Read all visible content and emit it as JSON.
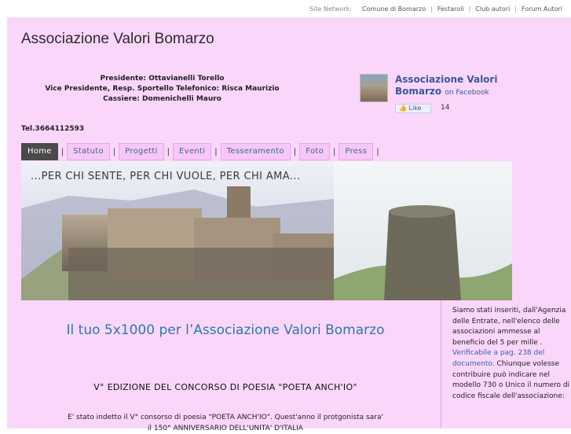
{
  "site_network": {
    "label": "Site Network:",
    "links": [
      "Comune di Bomarzo",
      "Festaroli",
      "Club autori",
      "Forum Autori"
    ],
    "separator": "|"
  },
  "header": {
    "title": "Associazione Valori Bomarzo",
    "officers": [
      "Presidente: Ottavianelli Torello",
      "Vice Presidente, Resp. Sportello Telefonico: Risca Maurizio",
      "Cassiere: Domenichelli Mauro"
    ],
    "tel": "Tel.3664112593"
  },
  "facebook": {
    "name": "Associazione Valori Bomarzo",
    "suffix": "on Facebook",
    "like_label": "Like",
    "like_count": "14"
  },
  "nav": {
    "tabs": [
      "Home",
      "Statuto",
      "Progetti",
      "Eventi",
      "Tesseramento",
      "Foto",
      "Press"
    ],
    "active": "Home",
    "separator": "|"
  },
  "banner": {
    "tagline": "...PER CHI SENTE, PER CHI VUOLE, PER CHI AMA..."
  },
  "main": {
    "five_per_mille_heading": "Il tuo 5x1000 per l’Associazione Valori Bomarzo",
    "contest_heading": "V° EDIZIONE DEL CONCORSO DI POESIA \"POETA ANCH'IO\"",
    "paragraph_line1": "E' stato indetto il V° consorso di poesia \"POETA ANCH'IO\". Quest'anno il protgonista sara'",
    "paragraph_line2": "il 150° ANNIVERSARIO DELL'UNITA' D'ITALIA"
  },
  "sidebar": {
    "text_before_link": "Siamo stati inseriti, dall'Agenzia delle Entrate, nell'elenco delle associazioni ammesse al beneficio del 5 per mille .",
    "link_text": "Verificabile a pag. 238 del documento.",
    "text_after_link": "Chiunque volesse contribuire può indicare nel modello 730 o Unico il numero di codice fiscale dell'associazione:"
  }
}
